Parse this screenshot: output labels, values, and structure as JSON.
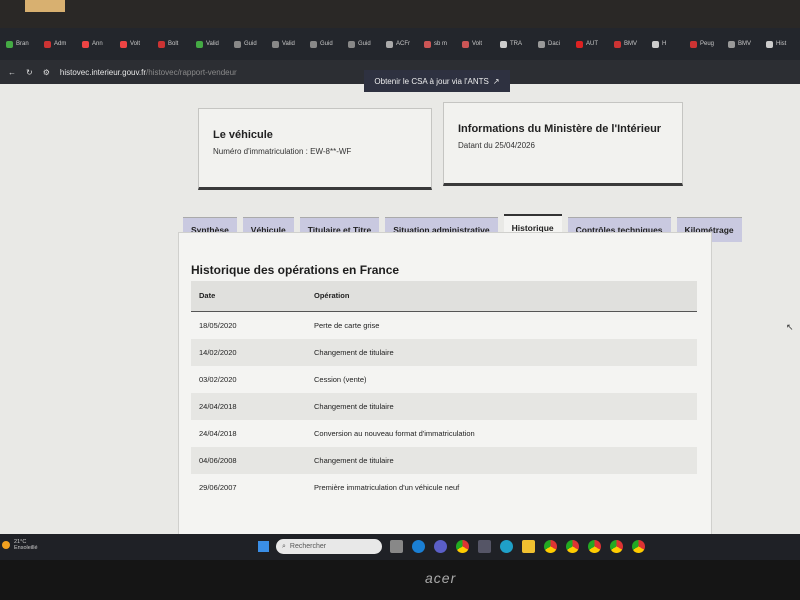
{
  "browser": {
    "tabs": [
      "Bran",
      "Adm",
      "Ann",
      "Volt",
      "Bolt",
      "Valid",
      "Guid",
      "Valid",
      "Guid",
      "Guid",
      "ACFr",
      "sb m",
      "Volt",
      "TRA",
      "Daci",
      "AUT",
      "BMV",
      "H",
      "Peug",
      "BMV",
      "Hist"
    ],
    "url_domain": "histovec.interieur.gouv.fr",
    "url_path": "/histovec/rapport-vendeur"
  },
  "page": {
    "csa_button": "Obtenir le CSA à jour via l'ANTS",
    "vehicle_card": {
      "title": "Le véhicule",
      "text": "Numéro d'immatriculation : EW-8**-WF"
    },
    "ministry_card": {
      "title": "Informations du Ministère de l'Intérieur",
      "text": "Datant du 25/04/2026"
    },
    "tabs": [
      "Synthèse",
      "Véhicule",
      "Titulaire et Titre",
      "Situation administrative",
      "Historique",
      "Contrôles techniques",
      "Kilométrage"
    ],
    "active_tab": "Historique",
    "section_title": "Historique des opérations en France",
    "table": {
      "headers": [
        "Date",
        "Opération"
      ],
      "rows": [
        [
          "18/05/2020",
          "Perte de carte grise"
        ],
        [
          "14/02/2020",
          "Changement de titulaire"
        ],
        [
          "03/02/2020",
          "Cession (vente)"
        ],
        [
          "24/04/2018",
          "Changement de titulaire"
        ],
        [
          "24/04/2018",
          "Conversion au nouveau format d'immatriculation"
        ],
        [
          "04/06/2008",
          "Changement de titulaire"
        ],
        [
          "29/06/2007",
          "Première immatriculation d'un véhicule neuf"
        ]
      ]
    }
  },
  "taskbar": {
    "temperature": "21°C",
    "weather": "Ensoleillé",
    "search_placeholder": "Rechercher"
  },
  "monitor_brand": "acer"
}
